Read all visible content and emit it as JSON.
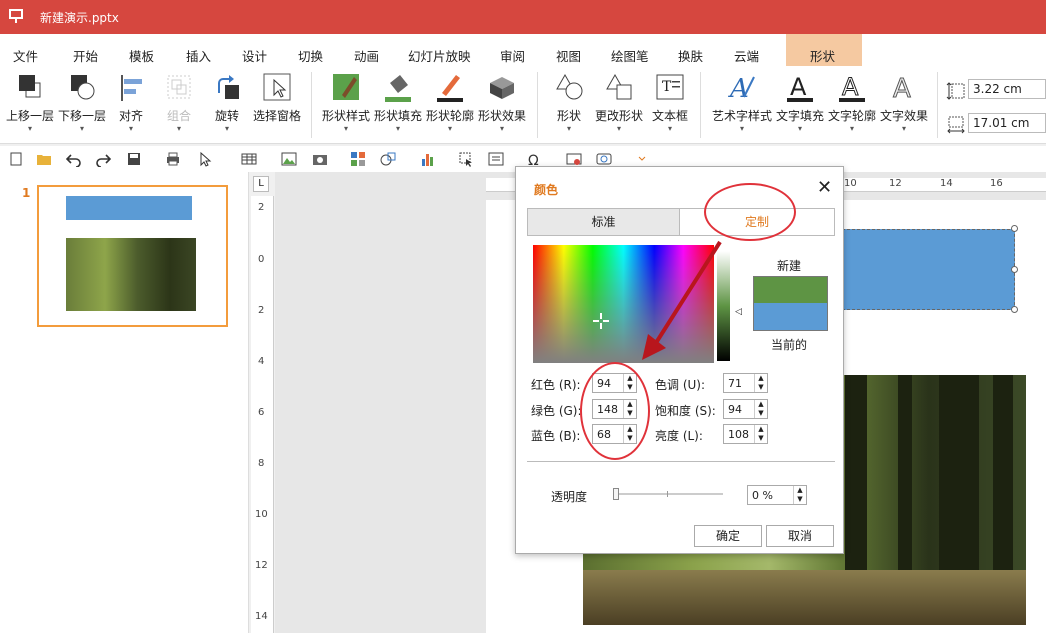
{
  "app": {
    "title": "新建演示.pptx",
    "icon": "presentation-icon"
  },
  "menu": {
    "tabs": [
      "文件",
      "开始",
      "模板",
      "插入",
      "设计",
      "切换",
      "动画",
      "幻灯片放映",
      "审阅",
      "视图",
      "绘图笔",
      "换肤",
      "云端"
    ],
    "active_tab": "形状"
  },
  "ribbon": {
    "bring_forward": "上移一层",
    "send_backward": "下移一层",
    "align": "对齐",
    "group": "组合",
    "rotate": "旋转",
    "selection_pane": "选择窗格",
    "shape_style": "形状样式",
    "shape_fill": "形状填充",
    "shape_outline": "形状轮廓",
    "shape_effect": "形状效果",
    "shape": "形状",
    "change_shape": "更改形状",
    "text_box": "文本框",
    "art_text_style": "艺术字样式",
    "text_fill": "文字填充",
    "text_outline": "文字轮廓",
    "text_effect": "文字效果",
    "height_value": "3.22 cm",
    "width_value": "17.01 cm"
  },
  "slides_panel": {
    "slide_number": "1"
  },
  "rulers": {
    "vertical": [
      "2",
      "0",
      "2",
      "4",
      "6",
      "8",
      "10",
      "12",
      "14"
    ],
    "horizontal": [
      "10",
      "12",
      "14",
      "16"
    ],
    "corner": "L"
  },
  "dialog": {
    "title": "颜色",
    "tab_standard": "标准",
    "tab_custom": "定制",
    "new_label": "新建",
    "current_label": "当前的",
    "new_color": "#5e9444",
    "current_color": "#5b9bd5",
    "red_label": "红色 (R):",
    "green_label": "绿色 (G):",
    "blue_label": "蓝色 (B):",
    "hue_label": "色调 (U):",
    "saturation_label": "饱和度 (S):",
    "luminance_label": "亮度 (L):",
    "red": "94",
    "green": "148",
    "blue": "68",
    "hue": "71",
    "saturation": "94",
    "luminance": "108",
    "transparency_label": "透明度",
    "transparency": "0 %",
    "ok": "确定",
    "cancel": "取消"
  },
  "annotation_color": "#e0323a"
}
